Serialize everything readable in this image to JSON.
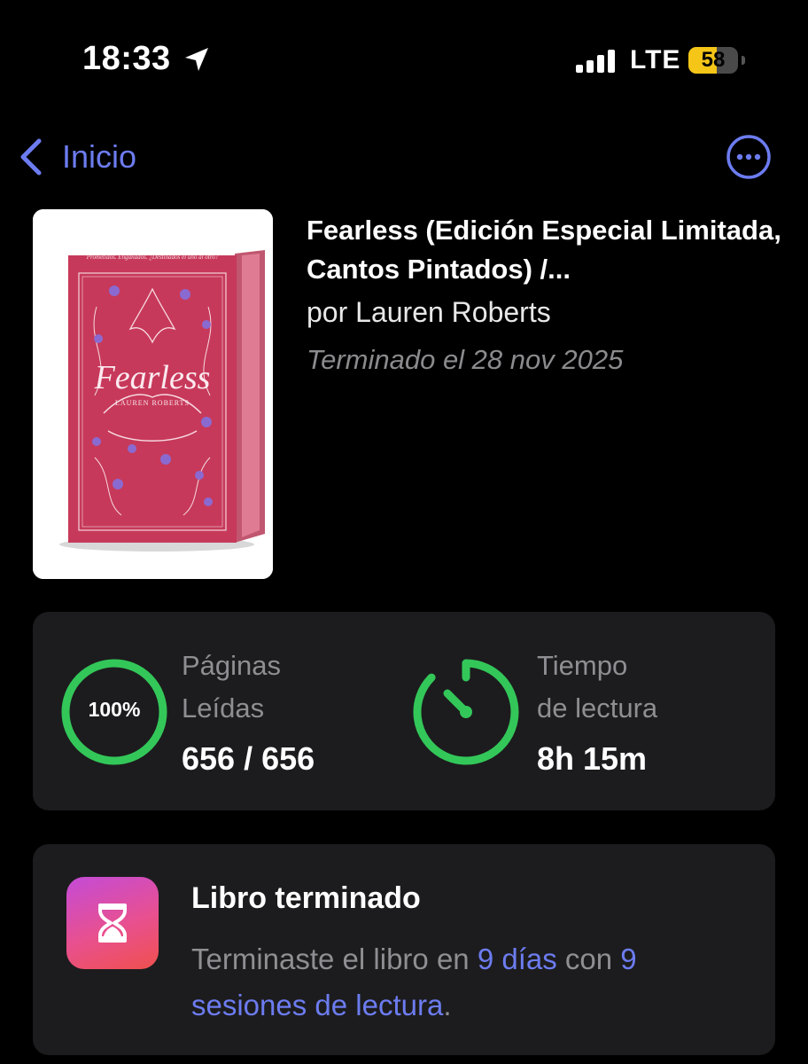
{
  "status_bar": {
    "time": "18:33",
    "network": "LTE",
    "battery_percent": "58",
    "battery_level": 0.58,
    "battery_color": "#f5c518"
  },
  "nav": {
    "back_label": "Inicio",
    "back_icon": "chevron-left-icon",
    "more_icon": "ellipsis-circle-icon",
    "accent_color": "#6c7cf0"
  },
  "book": {
    "title": "Fearless (Edición Especial Limitada, Cantos Pintados) /...",
    "author": "por Lauren Roberts",
    "finished_date": "Terminado el 28 nov 2025",
    "cover": {
      "tagline": "Prometidos. Engañados. ¿Destinados el uno al otro?",
      "title": "Fearless",
      "author": "LAUREN ROBERTS",
      "color": "#c7395a"
    }
  },
  "stats": {
    "pages": {
      "percent_label": "100%",
      "progress": 1.0,
      "label_line1": "Páginas",
      "label_line2": "Leídas",
      "value": "656 / 656"
    },
    "time": {
      "label_line1": "Tiempo",
      "label_line2": "de lectura",
      "value": "8h 15m",
      "icon": "timer-icon"
    },
    "ring_color": "#33c759"
  },
  "finished": {
    "icon": "hourglass-icon",
    "title": "Libro terminado",
    "text_before": "Terminaste el libro en ",
    "days": "9 días",
    "text_middle": " con ",
    "sessions": "9 sesiones de lectura",
    "text_after": "."
  }
}
